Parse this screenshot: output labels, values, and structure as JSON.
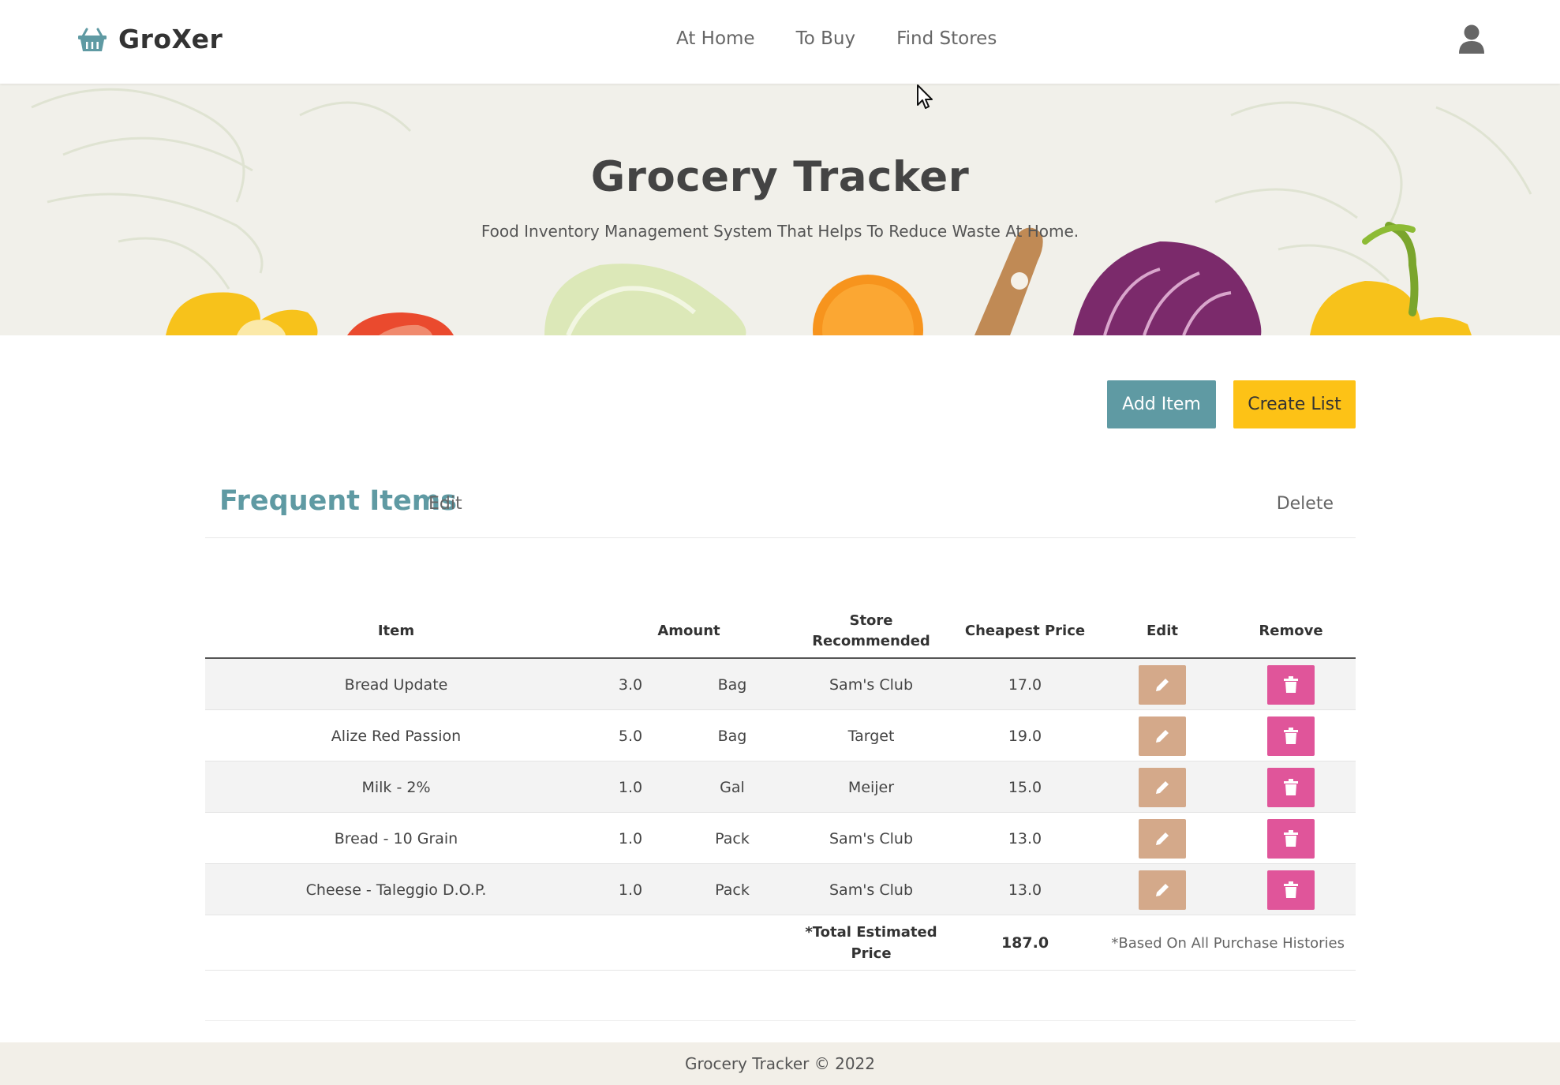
{
  "brand": {
    "name": "GroXer",
    "icon": "basket-icon",
    "accent": "#5f9aa3"
  },
  "nav": {
    "links": [
      "At Home",
      "To Buy",
      "Find Stores"
    ],
    "user_icon": "user-icon"
  },
  "hero": {
    "title": "Grocery Tracker",
    "subtitle": "Food Inventory Management System That Helps To Reduce Waste At Home."
  },
  "actions": {
    "add_item": "Add Item",
    "create_list": "Create List",
    "add_color": "#5f9aa3",
    "create_color": "#fdc216"
  },
  "section": {
    "title": "Frequent Items",
    "edit": "Edit",
    "delete": "Delete"
  },
  "table": {
    "headers": {
      "item": "Item",
      "amount": "Amount",
      "store": "Store Recommended",
      "price": "Cheapest Price",
      "edit": "Edit",
      "remove": "Remove"
    },
    "rows": [
      {
        "item": "Bread Update",
        "amount": "3.0",
        "unit": "Bag",
        "store": "Sam's Club",
        "price": "17.0"
      },
      {
        "item": "Alize Red Passion",
        "amount": "5.0",
        "unit": "Bag",
        "store": "Target",
        "price": "19.0"
      },
      {
        "item": "Milk - 2%",
        "amount": "1.0",
        "unit": "Gal",
        "store": "Meijer",
        "price": "15.0"
      },
      {
        "item": "Bread - 10 Grain",
        "amount": "1.0",
        "unit": "Pack",
        "store": "Sam's Club",
        "price": "13.0"
      },
      {
        "item": "Cheese - Taleggio D.O.P.",
        "amount": "1.0",
        "unit": "Pack",
        "store": "Sam's Club",
        "price": "13.0"
      }
    ],
    "edit_icon": "pencil-icon",
    "remove_icon": "trash-icon",
    "edit_color": "#d4a98a",
    "remove_color": "#e0559a",
    "total": {
      "label": "*Total Estimated Price",
      "value": "187.0",
      "note": "*Based On All Purchase Histories"
    }
  },
  "footer": {
    "text": "Grocery Tracker © 2022"
  }
}
